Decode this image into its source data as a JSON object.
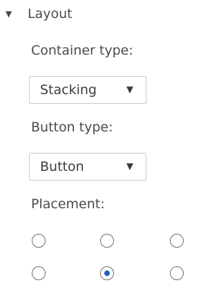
{
  "section": {
    "toggle_glyph": "▼",
    "title": "Layout"
  },
  "container_type": {
    "label": "Container type:",
    "value": "Stacking",
    "chevron": "▼"
  },
  "button_type": {
    "label": "Button type:",
    "value": "Button",
    "chevron": "▼"
  },
  "placement": {
    "label": "Placement:",
    "options": [
      {
        "row": 1,
        "col": 1,
        "selected": false
      },
      {
        "row": 1,
        "col": 2,
        "selected": false
      },
      {
        "row": 1,
        "col": 3,
        "selected": false
      },
      {
        "row": 2,
        "col": 1,
        "selected": false
      },
      {
        "row": 2,
        "col": 2,
        "selected": true
      },
      {
        "row": 2,
        "col": 3,
        "selected": false
      }
    ]
  },
  "colors": {
    "text": "#4a4a4a",
    "border": "#c9c9c9",
    "radio_selected": "#1e5fb4"
  }
}
